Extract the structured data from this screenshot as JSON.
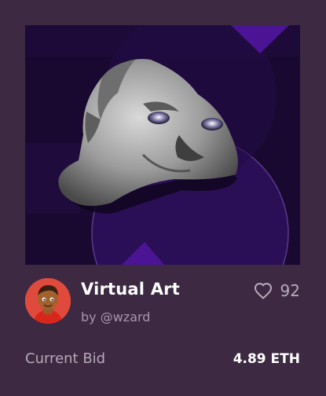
{
  "nft": {
    "title": "Virtual Art",
    "byline": "by @wzard",
    "likes": "92"
  },
  "bid": {
    "label": "Current Bid",
    "value": "4.89 ETH"
  },
  "icons": {
    "like": "heart-icon",
    "artwork": "sculpture-head-image",
    "avatar": "user-avatar-image"
  },
  "colors": {
    "page_background": "#3d2942",
    "artwork_background": "#190930",
    "accent_purple": "#4b1495",
    "avatar_background": "#e04a3c"
  }
}
